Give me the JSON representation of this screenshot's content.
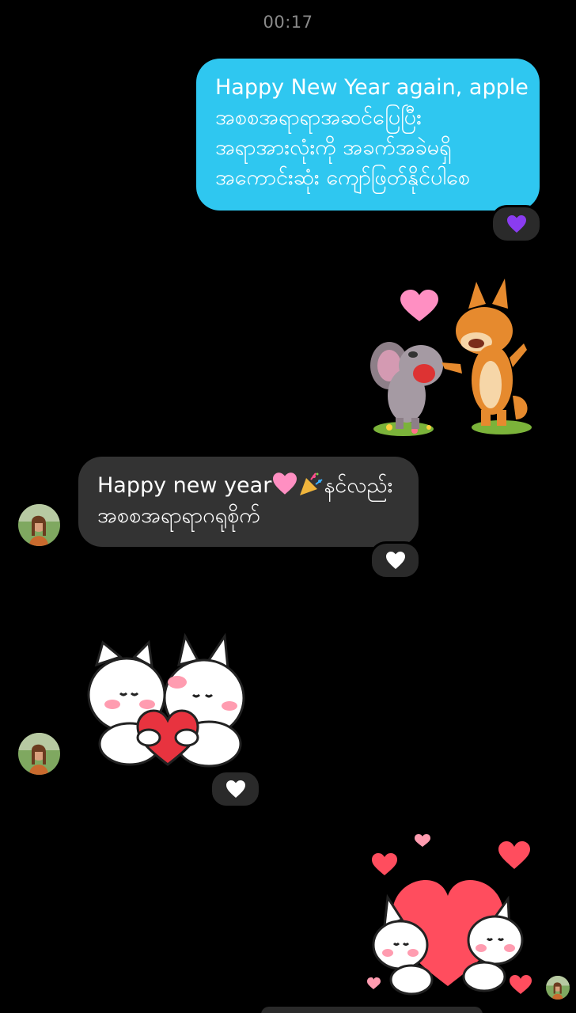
{
  "status": {
    "time": "00:17"
  },
  "messages": {
    "outgoing_text": {
      "lines": [
        "Happy New Year again, apple",
        "အစစအရာရာအဆင်ပြေပြီး",
        "အရာအားလုံးကို အခက်အခဲမရှိ",
        "အကောင်းဆုံး ကျော်ဖြတ်နိုင်ပါစေ"
      ],
      "reaction": "purple-heart",
      "bubble_color": "#2fc7f0"
    },
    "outgoing_sticker_1": {
      "sticker": "mouse-and-fox-celebrating"
    },
    "incoming_text": {
      "line1_prefix": "Happy new year",
      "line1_suffix": "နင်လည်း",
      "line2": "အစစအရာရာဂရုစိုက်",
      "emojis": [
        "pink-heart-emoji",
        "party-popper-emoji"
      ],
      "reaction": "white-heart",
      "bubble_color": "#333333"
    },
    "incoming_sticker": {
      "sticker": "two-cats-hugging-heart",
      "reaction": "white-heart"
    },
    "outgoing_sticker_2": {
      "sticker": "bunnies-with-big-heart"
    }
  },
  "colors": {
    "background": "#000000",
    "outgoing_bubble": "#2fc7f0",
    "incoming_bubble": "#333333",
    "reaction_pill": "#2a2a2a",
    "purple_heart": "#8a3cf0",
    "pink_heart": "#ff8fc2",
    "red_heart": "#ff4d5e"
  }
}
